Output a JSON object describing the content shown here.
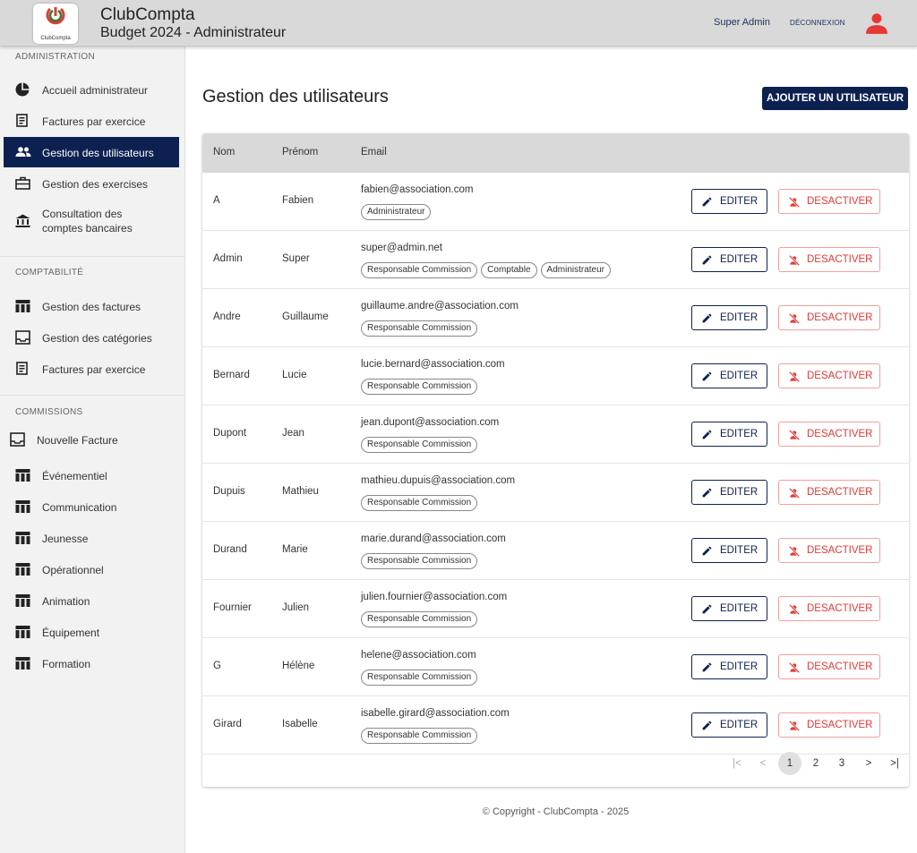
{
  "header": {
    "app_name": "ClubCompta",
    "subtitle": "Budget 2024 - Administrateur",
    "logo_text": "ClubCompta",
    "user_name": "Super Admin",
    "logout_label": "DÉCONNEXION",
    "accent_color": "#e53935",
    "brand_color": "#0d2150"
  },
  "sidebar": {
    "admin_title": "ADMINISTRATION",
    "admin_items": [
      {
        "label": "Accueil administrateur",
        "icon": "pie-chart-icon"
      },
      {
        "label": "Factures par exercice",
        "icon": "receipt-icon"
      },
      {
        "label": "Gestion des utilisateurs",
        "icon": "users-icon",
        "active": true
      },
      {
        "label": "Gestion des exercises",
        "icon": "briefcase-icon"
      },
      {
        "label": "Consultation des comptes bancaires",
        "line1": "Consultation des",
        "line2": "comptes bancaires",
        "icon": "bank-icon"
      }
    ],
    "compta_title": "COMPTABILITÉ",
    "compta_items": [
      {
        "label": "Gestion des factures",
        "icon": "table-icon"
      },
      {
        "label": "Gestion des catégories",
        "icon": "inbox-icon"
      },
      {
        "label": "Factures par exercice",
        "icon": "receipt-icon"
      }
    ],
    "commissions_title": "COMMISSIONS",
    "new_invoice": {
      "label": "Nouvelle Facture",
      "icon": "inbox-icon"
    },
    "commissions": [
      {
        "label": "Événementiel",
        "icon": "table-icon"
      },
      {
        "label": "Communication",
        "icon": "table-icon"
      },
      {
        "label": "Jeunesse",
        "icon": "table-icon"
      },
      {
        "label": "Opérationnel",
        "icon": "table-icon"
      },
      {
        "label": "Animation",
        "icon": "table-icon"
      },
      {
        "label": "Équipement",
        "icon": "table-icon"
      },
      {
        "label": "Formation",
        "icon": "table-icon"
      }
    ]
  },
  "main": {
    "title": "Gestion des utilisateurs",
    "add_button": "AJOUTER UN UTILISATEUR",
    "columns": {
      "nom": "Nom",
      "prenom": "Prénom",
      "email": "Email"
    },
    "edit_label": "EDITER",
    "deactivate_label": "DESACTIVER",
    "users": [
      {
        "nom": "A",
        "prenom": "Fabien",
        "email": "fabien@association.com",
        "roles": [
          "Administrateur"
        ]
      },
      {
        "nom": "Admin",
        "prenom": "Super",
        "email": "super@admin.net",
        "roles": [
          "Responsable Commission",
          "Comptable",
          "Administrateur"
        ]
      },
      {
        "nom": "Andre",
        "prenom": "Guillaume",
        "email": "guillaume.andre@association.com",
        "roles": [
          "Responsable Commission"
        ]
      },
      {
        "nom": "Bernard",
        "prenom": "Lucie",
        "email": "lucie.bernard@association.com",
        "roles": [
          "Responsable Commission"
        ]
      },
      {
        "nom": "Dupont",
        "prenom": "Jean",
        "email": "jean.dupont@association.com",
        "roles": [
          "Responsable Commission"
        ]
      },
      {
        "nom": "Dupuis",
        "prenom": "Mathieu",
        "email": "mathieu.dupuis@association.com",
        "roles": [
          "Responsable Commission"
        ]
      },
      {
        "nom": "Durand",
        "prenom": "Marie",
        "email": "marie.durand@association.com",
        "roles": [
          "Responsable Commission"
        ]
      },
      {
        "nom": "Fournier",
        "prenom": "Julien",
        "email": "julien.fournier@association.com",
        "roles": [
          "Responsable Commission"
        ]
      },
      {
        "nom": "G",
        "prenom": "Hélène",
        "email": "helene@association.com",
        "roles": [
          "Responsable Commission"
        ]
      },
      {
        "nom": "Girard",
        "prenom": "Isabelle",
        "email": "isabelle.girard@association.com",
        "roles": [
          "Responsable Commission"
        ]
      }
    ],
    "pagination": {
      "pages": [
        "1",
        "2",
        "3"
      ],
      "current": "1",
      "first": "|<",
      "prev": "<",
      "next": ">",
      "last": ">|"
    }
  },
  "footer": {
    "text": "© Copyright - ClubCompta - 2025"
  }
}
